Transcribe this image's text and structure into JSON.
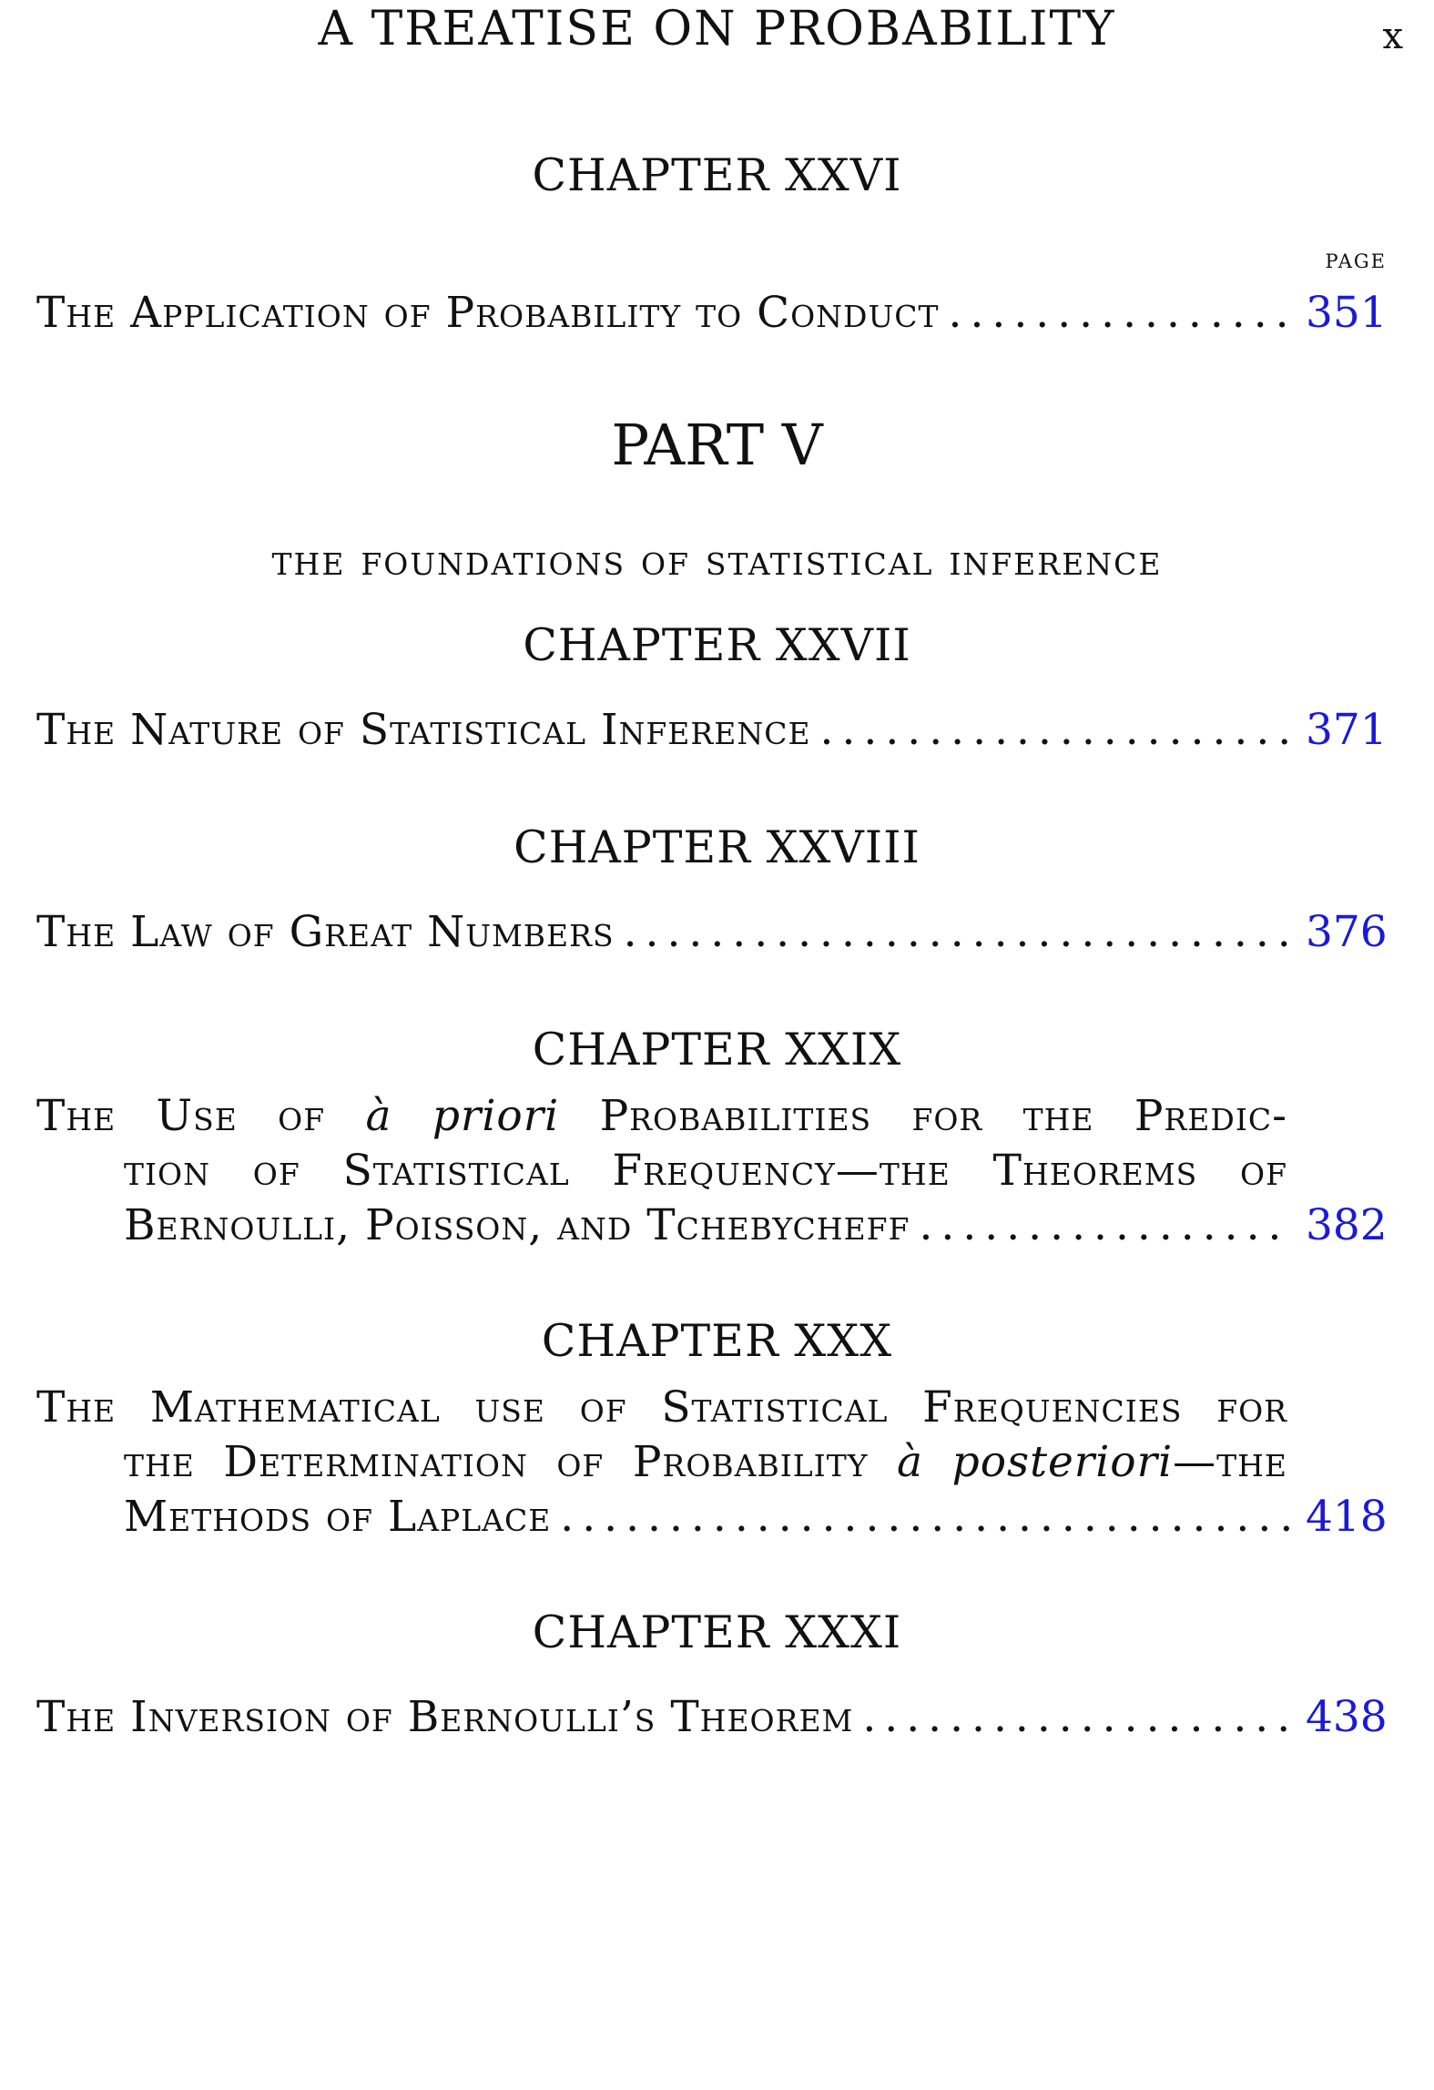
{
  "header": {
    "running_title": "A TREATISE ON PROBABILITY",
    "folio": "x"
  },
  "page_column_label": "PAGE",
  "ch26": {
    "heading": "CHAPTER XXVI",
    "title": "The Application of Probability to Conduct",
    "page": "351"
  },
  "part": {
    "heading": "PART V",
    "subtitle": "THE FOUNDATIONS OF STATISTICAL INFERENCE"
  },
  "ch27": {
    "heading": "CHAPTER XXVII",
    "title": "The Nature of Statistical Inference",
    "page": "371"
  },
  "ch28": {
    "heading": "CHAPTER XXVIII",
    "title": "The Law of Great Numbers",
    "page": "376"
  },
  "ch29": {
    "heading": "CHAPTER XXIX",
    "line1_a": "The Use of",
    "line1_italic": "à priori",
    "line1_b": "Probabilities for the Predic-",
    "line2": "tion of Statistical Frequency—the Theorems of",
    "line3": "Bernoulli, Poisson, and Tchebycheff",
    "page": "382"
  },
  "ch30": {
    "heading": "CHAPTER XXX",
    "line1": "The Mathematical use of Statistical Frequencies for",
    "line2_a": "the Determination of Probability",
    "line2_italic": "à posteriori",
    "line2_b": "—the",
    "line3": "Methods of Laplace",
    "page": "418"
  },
  "ch31": {
    "heading": "CHAPTER XXXI",
    "title": "The Inversion of Bernoulli’s Theorem",
    "page": "438"
  }
}
